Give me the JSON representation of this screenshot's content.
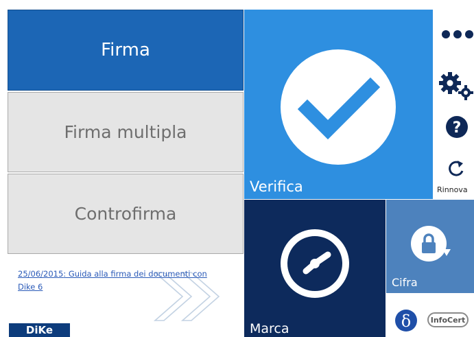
{
  "left_menu": {
    "firma_label": "Firma",
    "firma_multipla_label": "Firma multipla",
    "controfirma_label": "Controfirma"
  },
  "news": {
    "date": "25/06/2015",
    "text": ": Guida alla firma dei documenti con Dike 6"
  },
  "tiles": {
    "verifica_label": "Verifica",
    "marca_label": "Marca",
    "cifra_label": "Cifra"
  },
  "side_toolbar": {
    "rinnova_label": "Rinnova"
  },
  "branding": {
    "dike_label": "DiKe",
    "infocert_label": "InfoCert"
  },
  "colors": {
    "primary_blue": "#1c66b5",
    "verifica_blue": "#2e8fe0",
    "marca_navy": "#0d2a5c",
    "cifra_steel": "#4d82bd",
    "side_icon_navy": "#0e2857",
    "button_gray": "#e5e5e5"
  },
  "icons": {
    "more": "more-dots-icon",
    "settings": "gear-icon",
    "help": "question-icon",
    "renew": "refresh-icon",
    "verify": "checkmark-icon",
    "timestamp": "clock-icon",
    "encrypt": "lock-rotate-icon",
    "delta": "delta-logo-icon"
  }
}
